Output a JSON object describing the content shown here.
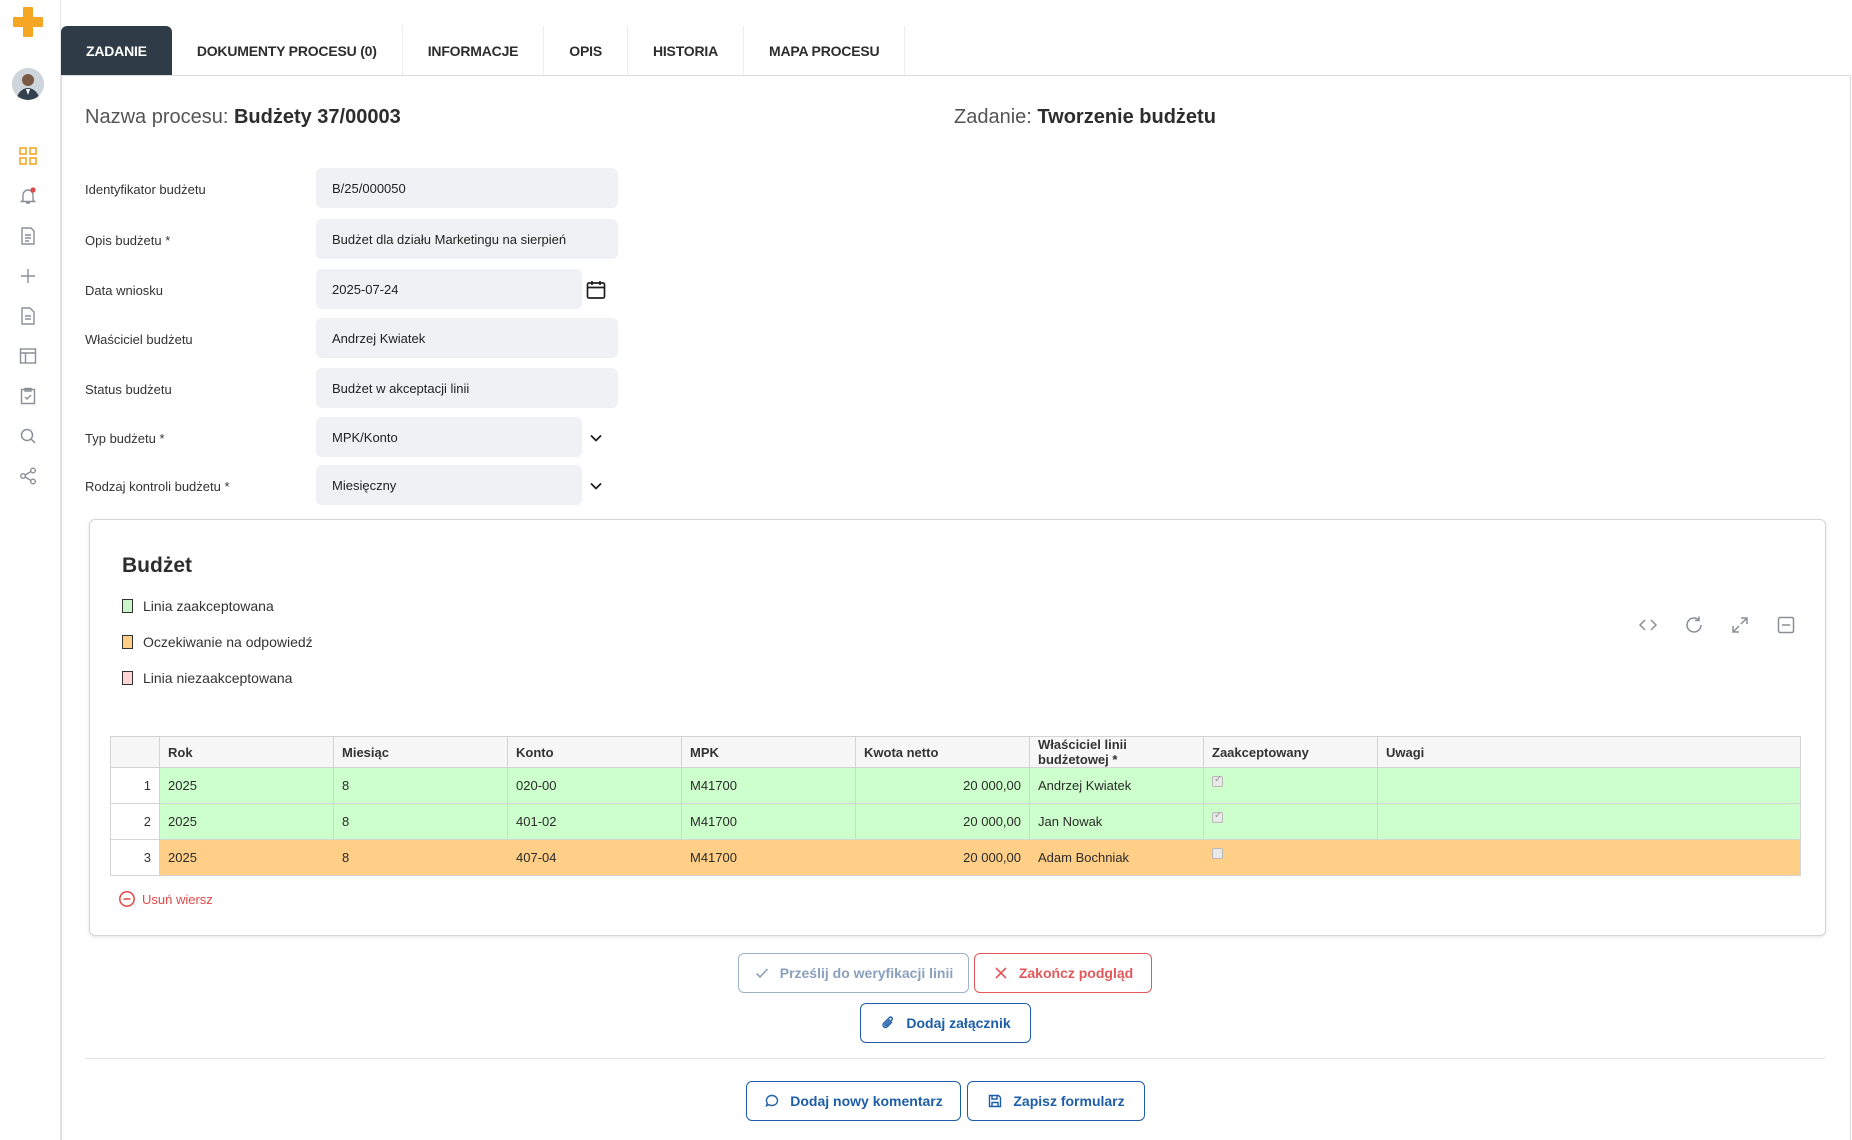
{
  "tabs": [
    {
      "label": "ZADANIE",
      "active": true
    },
    {
      "label": "DOKUMENTY PROCESU (0)"
    },
    {
      "label": "INFORMACJE"
    },
    {
      "label": "OPIS"
    },
    {
      "label": "HISTORIA"
    },
    {
      "label": "MAPA PROCESU"
    }
  ],
  "header": {
    "process_label": "Nazwa procesu:",
    "process_name": "Budżety 37/00003",
    "task_label": "Zadanie:",
    "task_name": "Tworzenie budżetu"
  },
  "form": {
    "fields": [
      {
        "label": "Identyfikator budżetu",
        "value": "B/25/000050"
      },
      {
        "label": "Opis budżetu *",
        "value": "Budżet dla działu Marketingu na sierpień"
      },
      {
        "label": "Data wniosku",
        "value": "2025-07-24",
        "icon": "calendar-icon"
      },
      {
        "label": "Właściciel budżetu",
        "value": "Andrzej Kwiatek"
      },
      {
        "label": "Status budżetu",
        "value": "Budżet w akceptacji linii"
      },
      {
        "label": "Typ budżetu *",
        "value": "MPK/Konto",
        "icon": "chevron-down-icon"
      },
      {
        "label": "Rodzaj kontroli budżetu *",
        "value": "Miesięczny",
        "icon": "chevron-down-icon"
      }
    ]
  },
  "budget": {
    "title": "Budżet",
    "legend": [
      {
        "label": "Linia zaakceptowana",
        "color": "#c9f7c9"
      },
      {
        "label": "Oczekiwanie na odpowiedź",
        "color": "#ffcf87"
      },
      {
        "label": "Linia niezaakceptowana",
        "color": "#ffd6d6"
      }
    ],
    "columns": [
      "Rok",
      "Miesiąc",
      "Konto",
      "MPK",
      "Kwota netto",
      "Właściciel linii budżetowej *",
      "Zaakceptowany",
      "Uwagi"
    ],
    "rows": [
      {
        "num": "1",
        "rok": "2025",
        "miesiac": "8",
        "konto": "020-00",
        "mpk": "M41700",
        "kwota": "20 000,00",
        "wlasciciel": "Andrzej Kwiatek",
        "accepted": true,
        "uwagi": "",
        "color": "#ccffcc"
      },
      {
        "num": "2",
        "rok": "2025",
        "miesiac": "8",
        "konto": "401-02",
        "mpk": "M41700",
        "kwota": "20 000,00",
        "wlasciciel": "Jan Nowak",
        "accepted": true,
        "uwagi": "",
        "color": "#ccffcc"
      },
      {
        "num": "3",
        "rok": "2025",
        "miesiac": "8",
        "konto": "407-04",
        "mpk": "M41700",
        "kwota": "20 000,00",
        "wlasciciel": "Adam Bochniak",
        "accepted": false,
        "uwagi": "",
        "color": "#ffcf87"
      }
    ],
    "remove_row_label": "Usuń wiersz"
  },
  "buttons": {
    "send_verification": "Prześlij do weryfikacji linii",
    "end_preview": "Zakończ podgląd",
    "add_attachment": "Dodaj załącznik",
    "add_comment": "Dodaj nowy komentarz",
    "save_form": "Zapisz formularz"
  },
  "colors": {
    "accent": "#f5a623",
    "primary": "#1e5ea8",
    "danger": "#e4585a",
    "active_tab": "#2f3b47"
  }
}
